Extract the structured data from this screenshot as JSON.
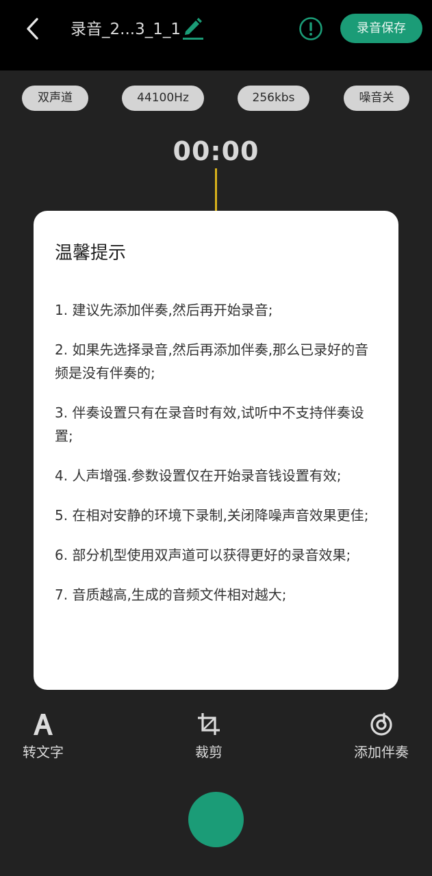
{
  "header": {
    "title": "录音_2...3_1_1",
    "save_label": "录音保存",
    "back_icon": "chevron-left-icon",
    "edit_icon": "pencil-icon",
    "info_icon": "exclamation-circle-icon"
  },
  "settings": {
    "channel": "双声道",
    "sample_rate": "44100Hz",
    "bitrate": "256kbs",
    "noise": "噪音关"
  },
  "timer": "00:00",
  "dialog": {
    "title": "温馨提示",
    "tips": [
      "1. 建议先添加伴奏,然后再开始录音;",
      "2. 如果先选择录音,然后再添加伴奏,那么已录好的音频是没有伴奏的;",
      "3. 伴奏设置只有在录音时有效,试听中不支持伴奏设置;",
      "4. 人声增强.参数设置仅在开始录音钱设置有效;",
      "5. 在相对安静的环境下录制,关闭降噪声音效果更佳;",
      "6. 部分机型使用双声道可以获得更好的录音效果;",
      "7. 音质越高,生成的音频文件相对越大;"
    ]
  },
  "tools": {
    "to_text": {
      "label": "转文字",
      "icon": "letter-a-icon"
    },
    "crop": {
      "label": "裁剪",
      "icon": "crop-icon"
    },
    "accompaniment": {
      "label": "添加伴奏",
      "icon": "music-disc-icon"
    }
  },
  "colors": {
    "accent": "#1b9c77",
    "background": "#222222",
    "topbar": "#000000",
    "playhead": "#d8b21b",
    "chip": "#d4d4d4"
  }
}
